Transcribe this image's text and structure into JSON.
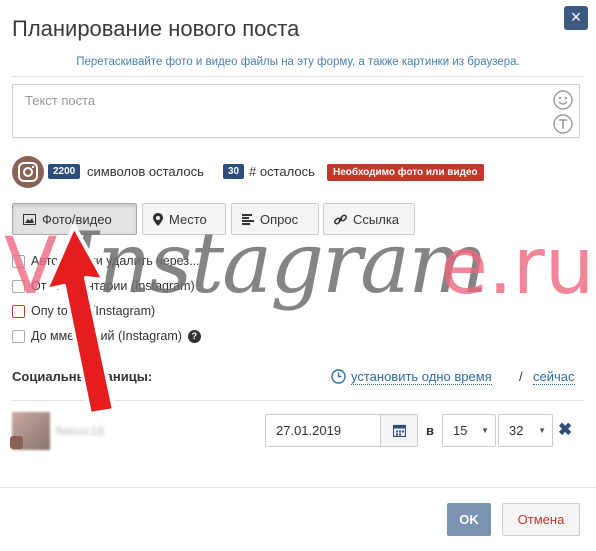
{
  "dialog": {
    "title": "Планирование нового поста",
    "close_glyph": "×",
    "hint": "Перетаскивайте фото и видео файлы на эту форму, а также картинки из браузера."
  },
  "post": {
    "placeholder": "Текст поста"
  },
  "counters": {
    "chars_value": "2200",
    "chars_label": "символов осталось",
    "hashtags_value": "30",
    "hashtags_label": "# осталось",
    "required_badge": "Необходимо фото или видео"
  },
  "tabs": [
    {
      "label": "Фото/видео",
      "icon": "image-icon",
      "active": true
    },
    {
      "label": "Место",
      "icon": "map-marker-icon"
    },
    {
      "label": "Опрос",
      "icon": "list-icon"
    },
    {
      "label": "Ссылка",
      "icon": "link-icon"
    }
  ],
  "options": [
    {
      "label": "Автом    пески удалить через..."
    },
    {
      "label": "Откл    мментарии (Instagram)"
    },
    {
      "label": "Опу         tories (Instagram)"
    },
    {
      "label": "До          мментарий (Instagram)"
    }
  ],
  "social": {
    "label": "Социальны    траницы:",
    "set_one_time": "установить одно время",
    "separator": "/",
    "now": "сейчас"
  },
  "schedule": {
    "account_name": "flatsoc18",
    "date": "27.01.2019",
    "at_label": "в",
    "hour": "15",
    "minute": "32"
  },
  "footer": {
    "ok": "OK",
    "cancel": "Отмена"
  },
  "watermark": {
    "part1": "V",
    "part2": "Instagram",
    "part3": "e.ru"
  },
  "colors": {
    "primary": "#2d4e7a",
    "danger": "#c0392b",
    "link": "#2d6da3",
    "watermark_pink": "#ec687d"
  }
}
